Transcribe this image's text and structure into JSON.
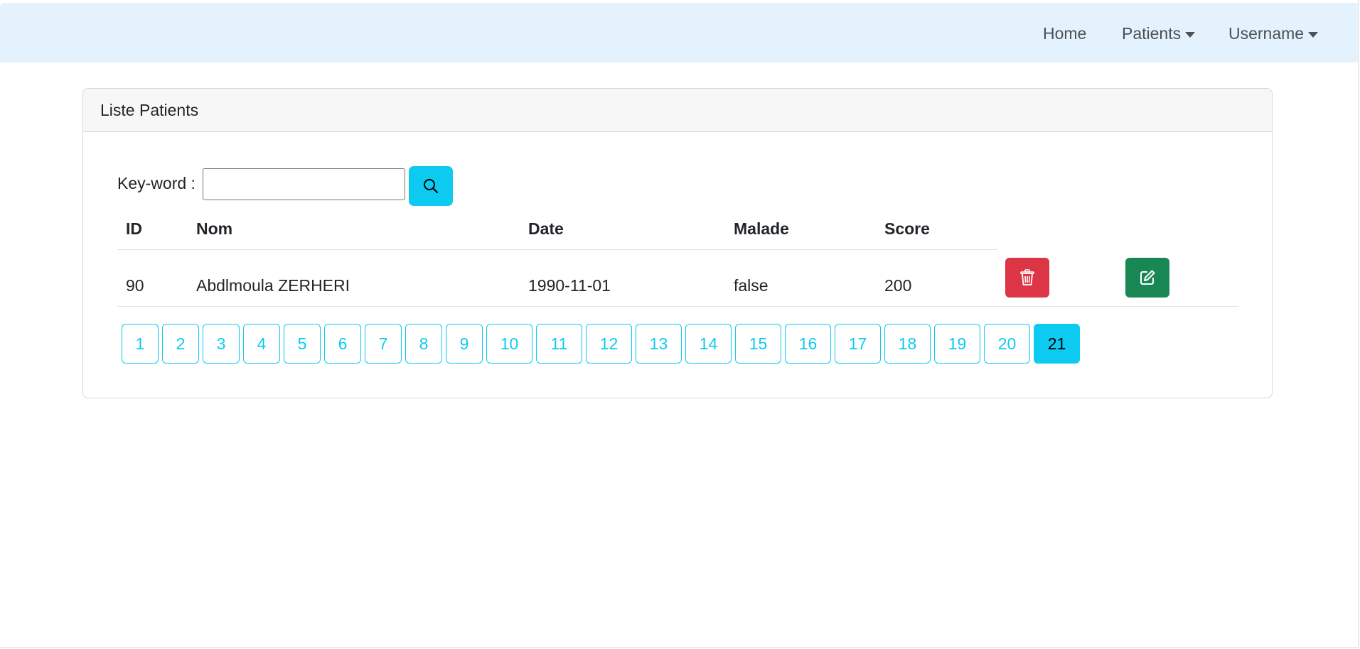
{
  "navbar": {
    "home": "Home",
    "patients": "Patients",
    "username": "Username"
  },
  "card": {
    "title": "Liste Patients"
  },
  "search": {
    "label": "Key-word :",
    "value": "",
    "placeholder": "",
    "icon": "search-icon"
  },
  "table": {
    "headers": [
      "ID",
      "Nom",
      "Date",
      "Malade",
      "Score"
    ],
    "rows": [
      {
        "id": "90",
        "nom": "Abdlmoula ZERHERI",
        "date": "1990-11-01",
        "malade": "false",
        "score": "200",
        "delete_icon": "trash-icon",
        "edit_icon": "edit-icon"
      }
    ]
  },
  "pagination": {
    "pages": [
      "1",
      "2",
      "3",
      "4",
      "5",
      "6",
      "7",
      "8",
      "9",
      "10",
      "11",
      "12",
      "13",
      "14",
      "15",
      "16",
      "17",
      "18",
      "19",
      "20",
      "21"
    ],
    "current": "21"
  },
  "colors": {
    "navbar_bg": "#e3f2fd",
    "info": "#0dcaf0",
    "danger": "#dc3545",
    "success": "#198754"
  }
}
